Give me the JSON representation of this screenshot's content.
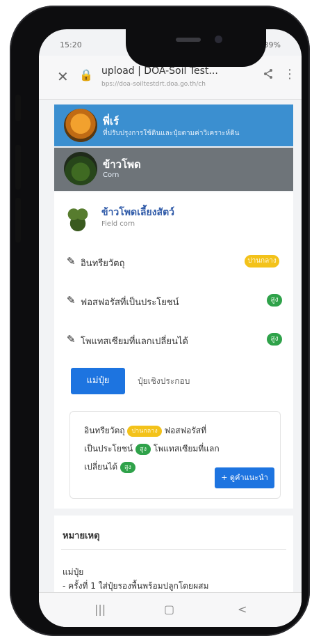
{
  "status": {
    "time": "15:20",
    "right": "..ıl 39%"
  },
  "browser": {
    "close_icon": "✕",
    "lock_icon": "🔒",
    "title": "upload | DOA-Soil Test...",
    "url": "bps://doa-soiltestdrt.doa.go.th/ch",
    "share_icon": "share-icon",
    "menu_icon": "⋮"
  },
  "headers": {
    "user": {
      "name": "พี่เร์",
      "sub": "ที่ปรับปรุงการใช้ดินและปุ๋ยตามค่าวิเคราะห์ดิน"
    },
    "crop": {
      "name": "ข้าวโพด",
      "sub": "Corn"
    }
  },
  "crop_detail": {
    "name": "ข้าวโพดเลี้ยงสัตว์",
    "sub": "Field corn"
  },
  "list": [
    {
      "label": "อินทรียวัตถุ",
      "badge": "ปานกลาง",
      "badge_color": "#f3c21a"
    },
    {
      "label": "ฟอสฟอรัสที่เป็นประโยชน์",
      "badge": "สูง",
      "badge_color": "#2fa24a"
    },
    {
      "label": "โพแทสเซียมที่แลกเปลี่ยนได้",
      "badge": "สูง",
      "badge_color": "#2fa24a"
    }
  ],
  "tabs": {
    "active": "แม่ปุ๋ย",
    "other": "ปุ๋ยเชิงประกอบ"
  },
  "card": {
    "line1_a": "อินทรียวัตถุ",
    "badge1": "ปานกลาง",
    "line1_b": "ฟอสฟอรัสที่",
    "line2_a": "เป็นประโยชน์",
    "badge2": "สูง",
    "line2_b": "โพแทสเซียมที่แลก",
    "line3_a": "เปลี่ยนได้",
    "badge3": "สูง",
    "button": "+ ดูคำแนะนำ"
  },
  "notes": {
    "title": "หมายเหตุ",
    "l1": "แม่ปุ๋ย",
    "l2": "- ครั้งที่ 1 ใส่ปุ๋ยรองพื้นพร้อมปลูกโดยผสม"
  },
  "colors": {
    "header_blue": "#3b8fd0",
    "header_gray": "#6e7479",
    "primary": "#1d74e0"
  }
}
